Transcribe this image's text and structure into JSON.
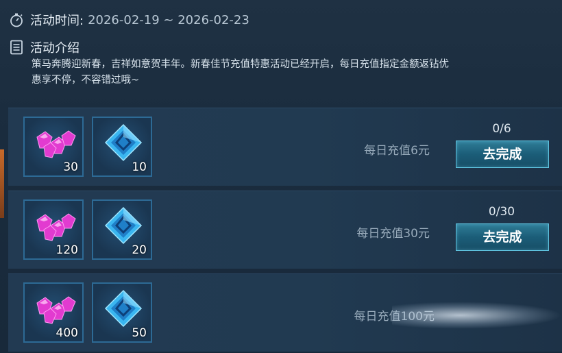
{
  "header": {
    "time_label": "活动时间:",
    "time_range": "2026-02-19 ~ 2026-02-23",
    "intro_title": "活动介绍",
    "intro_text": "策马奔腾迎新春，吉祥如意贺丰年。新春佳节充值特惠活动已经开启，每日充值指定金额返钻优惠享不停，不容错过哦~"
  },
  "icons": {
    "time": "stopwatch-icon",
    "intro": "document-list-icon"
  },
  "colors": {
    "gem_pink": "#e23bd0",
    "crystal_blue": "#3ab6f0",
    "button": "#1f6a86"
  },
  "tasks": [
    {
      "condition": "每日充值6元",
      "progress": "0/6",
      "button": "去完成",
      "rewards": [
        {
          "icon": "pink-gem-icon",
          "qty": "30"
        },
        {
          "icon": "blue-crystal-icon",
          "qty": "10"
        }
      ]
    },
    {
      "condition": "每日充值30元",
      "progress": "0/30",
      "button": "去完成",
      "rewards": [
        {
          "icon": "pink-gem-icon",
          "qty": "120"
        },
        {
          "icon": "blue-crystal-icon",
          "qty": "20"
        }
      ]
    },
    {
      "condition": "每日充值100元",
      "progress": "",
      "button": "",
      "rewards": [
        {
          "icon": "pink-gem-icon",
          "qty": "400"
        },
        {
          "icon": "blue-crystal-icon",
          "qty": "50"
        }
      ]
    }
  ]
}
